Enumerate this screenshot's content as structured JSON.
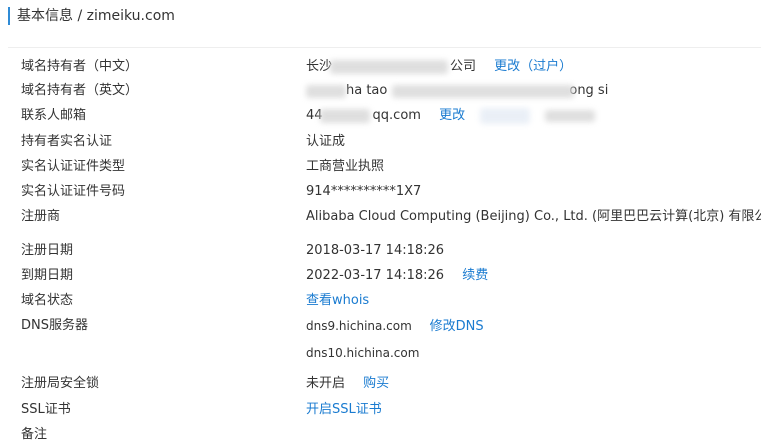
{
  "header": {
    "title": "基本信息 / zimeiku.com"
  },
  "rows": {
    "owner_cn": {
      "label": "域名持有者（中文）",
      "value": "长沙",
      "value_tail": "公司",
      "links": [
        "更改（过户）"
      ]
    },
    "owner_en": {
      "label": "域名持有者（英文）",
      "value_mid": "ha tao",
      "value_tail": "ong si"
    },
    "email": {
      "label": "联系人邮箱",
      "value": "44",
      "value_tail": "qq.com",
      "links": [
        "更改"
      ]
    },
    "verify": {
      "label": "持有者实名认证",
      "value": "认证成"
    },
    "cert_type": {
      "label": "实名认证证件类型",
      "value": "工商营业执照"
    },
    "cert_no": {
      "label": "实名认证证件号码",
      "value": "914**********1X7"
    },
    "registrar": {
      "label": "注册商",
      "value": "Alibaba Cloud Computing (Beijing) Co., Ltd. (阿里巴巴云计算(北京) 有限公"
    },
    "reg_date": {
      "label": "注册日期",
      "value": "2018-03-17 14:18:26"
    },
    "exp_date": {
      "label": "到期日期",
      "value": "2022-03-17 14:18:26",
      "links": [
        "续费"
      ]
    },
    "status": {
      "label": "域名状态",
      "links": [
        "查看whois"
      ]
    },
    "dns": {
      "label": "DNS服务器",
      "value": "dns9.hichina.com",
      "value2": "dns10.hichina.com",
      "links": [
        "修改DNS"
      ]
    },
    "lock": {
      "label": "注册局安全锁",
      "value": "未开启",
      "links": [
        "购买"
      ]
    },
    "ssl": {
      "label": "SSL证书",
      "links": [
        "开启SSL证书"
      ]
    },
    "note": {
      "label": "备注"
    }
  },
  "colors": {
    "accent": "#1a7bd0",
    "header_bar": "#2f8bd6",
    "text": "#333333"
  }
}
